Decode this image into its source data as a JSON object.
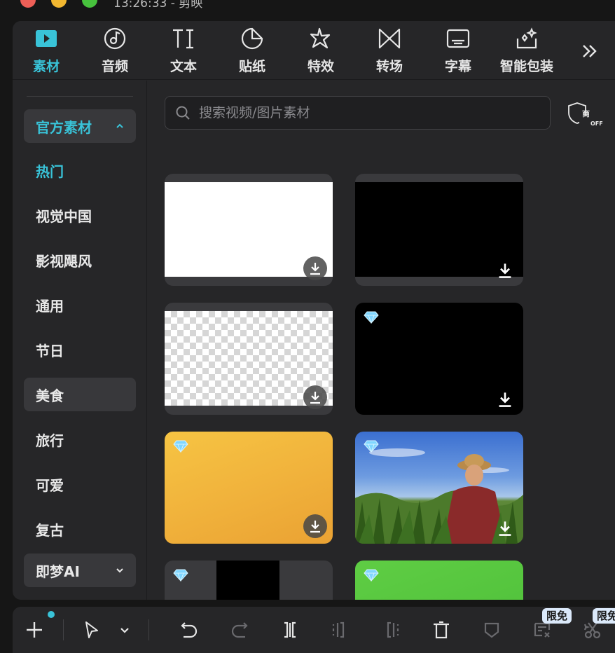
{
  "window": {
    "title": "13:26:33 - 剪映"
  },
  "nav": {
    "tabs": [
      {
        "label": "素材",
        "icon": "media-icon",
        "active": true
      },
      {
        "label": "音频",
        "icon": "audio-icon",
        "active": false
      },
      {
        "label": "文本",
        "icon": "text-icon",
        "active": false
      },
      {
        "label": "贴纸",
        "icon": "sticker-icon",
        "active": false
      },
      {
        "label": "特效",
        "icon": "effects-icon",
        "active": false
      },
      {
        "label": "转场",
        "icon": "transition-icon",
        "active": false
      },
      {
        "label": "字幕",
        "icon": "subtitle-icon",
        "active": false
      },
      {
        "label": "智能包装",
        "icon": "smart-package-icon",
        "active": false
      }
    ],
    "more_icon": "double-chevron-right-icon"
  },
  "sidebar": {
    "group_top": {
      "label": "官方素材",
      "expanded": true
    },
    "items": [
      {
        "label": "热门",
        "active": true
      },
      {
        "label": "视觉中国",
        "active": false
      },
      {
        "label": "影视飓风",
        "active": false
      },
      {
        "label": "通用",
        "active": false
      },
      {
        "label": "节日",
        "active": false
      },
      {
        "label": "美食",
        "active": false,
        "hovered": true
      },
      {
        "label": "旅行",
        "active": false
      },
      {
        "label": "可爱",
        "active": false
      },
      {
        "label": "复古",
        "active": false
      }
    ],
    "group_bottom": {
      "label": "即梦AI",
      "expanded": false
    }
  },
  "search": {
    "placeholder": "搜索视频/图片素材",
    "value": ""
  },
  "commercial_toggle": {
    "label": "商",
    "sub_label": "OFF"
  },
  "grid": {
    "items": [
      {
        "name": "white-background",
        "premium": false,
        "download_style": "circle"
      },
      {
        "name": "black-background",
        "premium": false,
        "download_style": "plain"
      },
      {
        "name": "transparent-background",
        "premium": false,
        "download_style": "circle"
      },
      {
        "name": "black-premium",
        "premium": true,
        "download_style": "plain"
      },
      {
        "name": "orange-gradient",
        "premium": true,
        "download_style": "circle"
      },
      {
        "name": "farmer-in-field",
        "premium": true,
        "download_style": "plain"
      },
      {
        "name": "black-bars",
        "premium": true,
        "download_style": "none"
      },
      {
        "name": "green-background",
        "premium": true,
        "download_style": "none"
      }
    ]
  },
  "toolbar": {
    "badges": [
      "限免",
      "限免"
    ],
    "accent": "#39c3d8"
  },
  "colors": {
    "accent": "#39c3d8",
    "panel": "#262628",
    "background": "#161616"
  }
}
